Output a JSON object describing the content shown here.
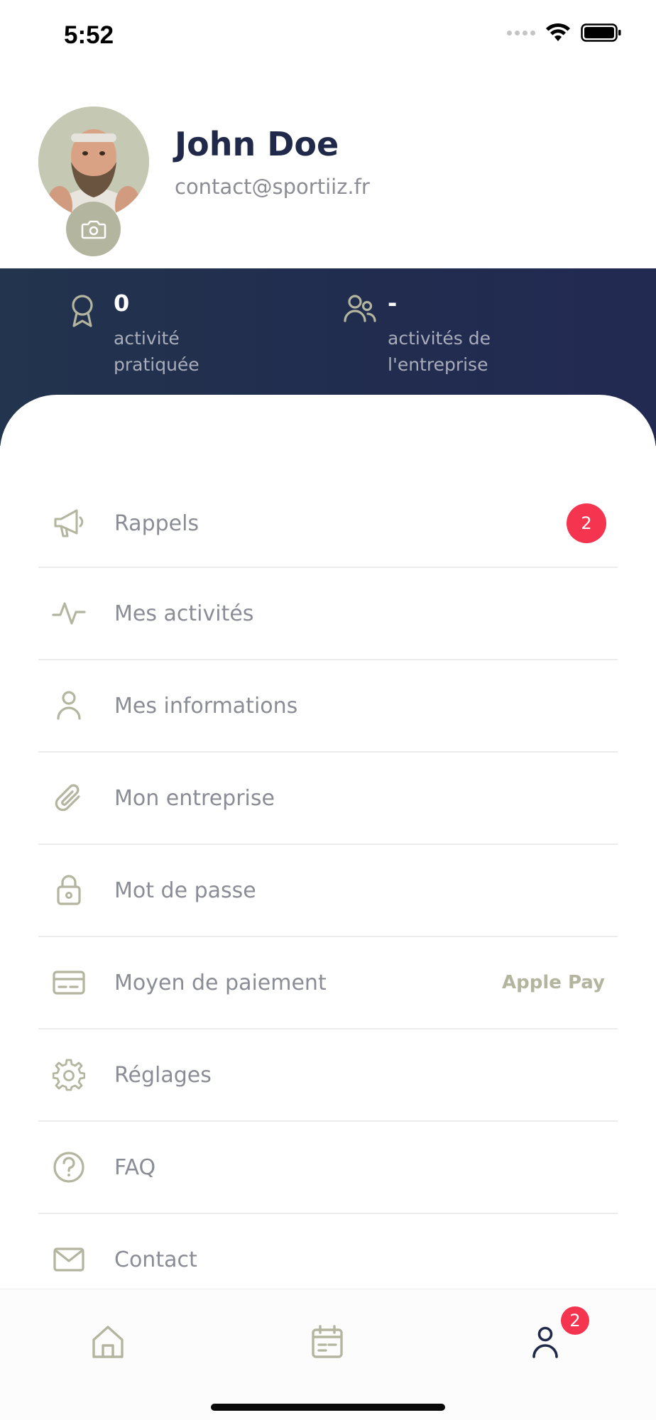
{
  "status_bar": {
    "time": "5:52"
  },
  "profile": {
    "name": "John Doe",
    "email": "contact@sportiiz.fr"
  },
  "stats": [
    {
      "icon": "award-icon",
      "value": "0",
      "label": "activité pratiquée"
    },
    {
      "icon": "users-icon",
      "value": "-",
      "label": "activités de l'entreprise"
    }
  ],
  "menu": {
    "items": [
      {
        "icon": "megaphone-icon",
        "label": "Rappels",
        "badge": "2"
      },
      {
        "icon": "activity-icon",
        "label": "Mes activités"
      },
      {
        "icon": "user-icon",
        "label": "Mes informations"
      },
      {
        "icon": "paperclip-icon",
        "label": "Mon entreprise"
      },
      {
        "icon": "lock-icon",
        "label": "Mot de passe"
      },
      {
        "icon": "credit-card-icon",
        "label": "Moyen de paiement",
        "value": "Apple Pay"
      },
      {
        "icon": "gear-icon",
        "label": "Réglages"
      },
      {
        "icon": "help-circle-icon",
        "label": "FAQ"
      },
      {
        "icon": "mail-icon",
        "label": "Contact"
      }
    ]
  },
  "tab_bar": {
    "tabs": [
      {
        "icon": "home-icon",
        "active": false
      },
      {
        "icon": "calendar-icon",
        "active": false
      },
      {
        "icon": "profile-icon",
        "active": true,
        "badge": "2"
      }
    ]
  },
  "colors": {
    "accent": "#b3b59e",
    "navy": "#20294a",
    "badge": "#f5354f",
    "text_muted": "#8a8c96"
  }
}
